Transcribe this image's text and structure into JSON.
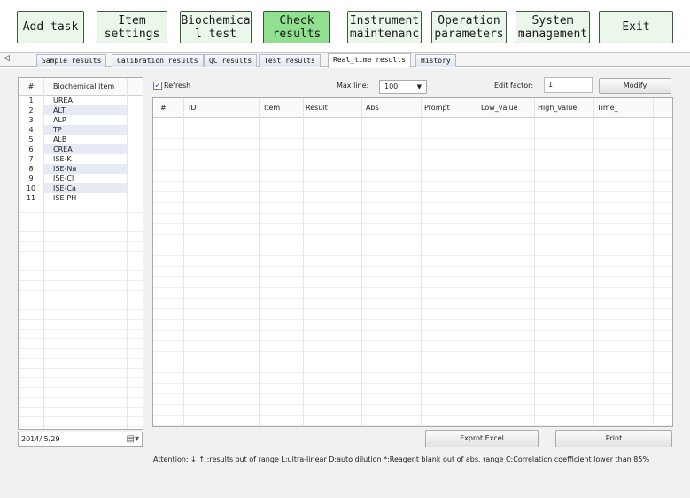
{
  "toolbar": {
    "buttons": [
      {
        "label": "Add task"
      },
      {
        "label": "Item\nsettings"
      },
      {
        "label": "Biochemica\nl test"
      },
      {
        "label": "Check\nresults"
      },
      {
        "label": "Instrument\nmaintenanc"
      },
      {
        "label": "Operation\nparameters"
      },
      {
        "label": "System\nmanagement"
      },
      {
        "label": "Exit"
      }
    ]
  },
  "tabs": {
    "scroll_arrow": "◁",
    "items": [
      {
        "label": "Sample results"
      },
      {
        "label": "Calibration results"
      },
      {
        "label": "QC results"
      },
      {
        "label": "Test results"
      },
      {
        "label": "Real_time results"
      },
      {
        "label": "History"
      }
    ]
  },
  "item_list": {
    "headers": {
      "num": "#",
      "name": "Biochemical item"
    },
    "rows": [
      {
        "num": "1",
        "name": "UREA"
      },
      {
        "num": "2",
        "name": "ALT"
      },
      {
        "num": "3",
        "name": "ALP"
      },
      {
        "num": "4",
        "name": "TP"
      },
      {
        "num": "5",
        "name": "ALB"
      },
      {
        "num": "6",
        "name": "CREA"
      },
      {
        "num": "7",
        "name": "ISE-K"
      },
      {
        "num": "8",
        "name": "ISE-Na"
      },
      {
        "num": "9",
        "name": "ISE-Cl"
      },
      {
        "num": "10",
        "name": "ISE-Ca"
      },
      {
        "num": "11",
        "name": "ISE-PH"
      }
    ]
  },
  "date": {
    "value": "2014/ 5/29",
    "icon": "calendar-dropdown-icon"
  },
  "controls": {
    "refresh_label": "Refresh",
    "refresh_checked": true,
    "maxline_label": "Max line:",
    "maxline_value": "100",
    "edit_factor_label": "Edit factor:",
    "edit_factor_value": "1",
    "modify_label": "Modify"
  },
  "grid": {
    "columns": [
      "#",
      "ID",
      "Item",
      "Result",
      "Abs",
      "Prompt",
      "Low_value",
      "High_value",
      "Time_"
    ]
  },
  "buttons": {
    "export_label": "Exprot Excel",
    "print_label": "Print"
  },
  "attention": "Attention:  ↓ ↑ :results out of range   L:ultra-linear   D:auto dilution    *:Reagent blank out of abs. range   C:Correlation coefficient lower than 85%"
}
